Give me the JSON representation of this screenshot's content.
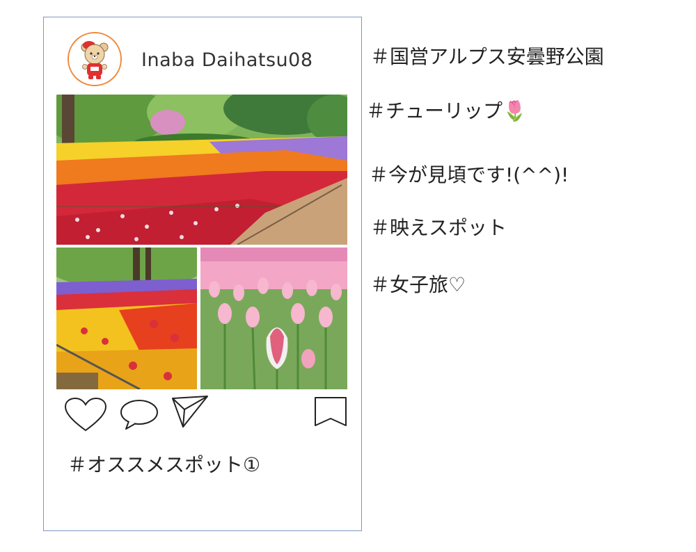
{
  "post": {
    "username": "Inaba Daihatsu08",
    "caption": "＃オススメスポット①"
  },
  "hashtags": [
    "＃国営アルプス安曇野公園",
    "＃チューリップ🌷",
    "＃今が見頃です!(^^)!",
    "＃映えスポット",
    "＃女子旅♡"
  ],
  "icons": {
    "like": "heart-icon",
    "comment": "speech-bubble-icon",
    "share": "paper-plane-icon",
    "save": "bookmark-icon"
  },
  "colors": {
    "frame_border": "#7d97bf",
    "avatar_border": "#f08a3c"
  }
}
